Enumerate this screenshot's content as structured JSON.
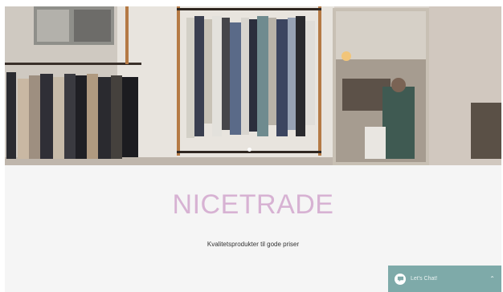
{
  "hero": {
    "image": "clothing-store-rails",
    "slide_indicators": 1
  },
  "brand": {
    "name": "NICETRADE",
    "tagline": "Kvalitetsprodukter til gode priser",
    "color": "#d7b2d3"
  },
  "chat": {
    "label": "Let's Chat!",
    "icon": "chat-bubble-icon",
    "caret_icon": "chevron-up-icon",
    "color": "#7eaaa9"
  }
}
